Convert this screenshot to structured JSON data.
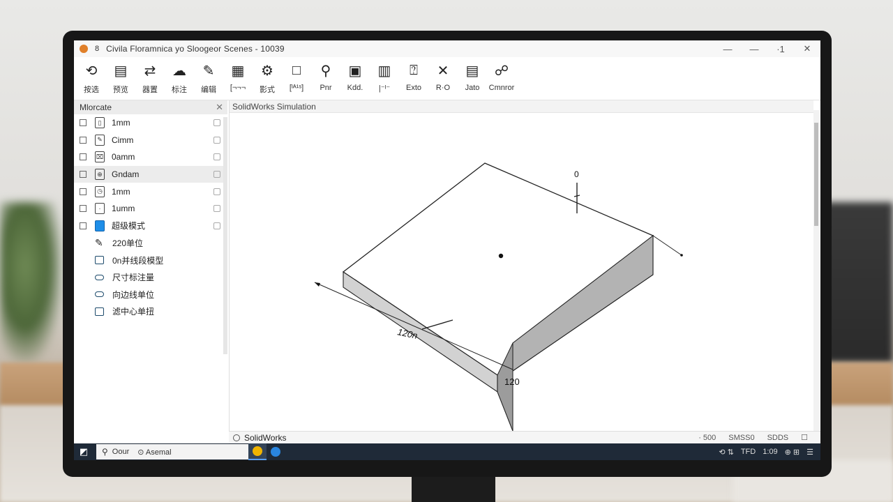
{
  "window": {
    "title": "Civila Floramnica yo Sloogeor Scenes - 10039",
    "pin": "8",
    "minimize": "—",
    "restore": "—",
    "extra": "·1",
    "close": "✕"
  },
  "toolbar": {
    "items": [
      {
        "icon": "⟲",
        "label": "按选",
        "icon_name": "sketch-icon"
      },
      {
        "icon": "▤",
        "label": "预览",
        "icon_name": "preview-icon"
      },
      {
        "icon": "⇄",
        "label": "器置",
        "icon_name": "swap-icon"
      },
      {
        "icon": "☁",
        "label": "标注",
        "icon_name": "cloud-icon"
      },
      {
        "icon": "✎",
        "label": "编辑",
        "icon_name": "edit-icon"
      },
      {
        "icon": "▦",
        "label": "[¬¬¬",
        "icon_name": "document-icon"
      },
      {
        "icon": "⚙",
        "label": "影式",
        "icon_name": "mode-icon"
      },
      {
        "icon": "□",
        "label": "[ᴵᴬ¹ˢ]",
        "icon_name": "box-icon"
      },
      {
        "icon": "⚲",
        "label": "Pnr",
        "icon_name": "pin-icon"
      },
      {
        "icon": "▣",
        "label": "Kdd.",
        "icon_name": "kd-icon"
      },
      {
        "icon": "▥",
        "label": "|⁻ᴵ⁻",
        "icon_name": "frame-icon"
      },
      {
        "icon": "⍰",
        "label": "Exto",
        "icon_name": "extrude-icon"
      },
      {
        "icon": "✕",
        "label": "R·O",
        "icon_name": "cross-icon"
      },
      {
        "icon": "▤",
        "label": "Jato",
        "icon_name": "list-icon"
      },
      {
        "icon": "☍",
        "label": "Cmnror",
        "icon_name": "hand-icon"
      }
    ]
  },
  "feature_manager": {
    "title": "Mlorcate",
    "close": "✕",
    "items": [
      {
        "label": "1mm",
        "icon": "▯",
        "selected": false
      },
      {
        "label": "Cimm",
        "icon": "✎",
        "selected": false
      },
      {
        "label": "0amm",
        "icon": "⌧",
        "selected": false
      },
      {
        "label": "Gndam",
        "icon": "⊕",
        "selected": true
      },
      {
        "label": "1mm",
        "icon": "◷",
        "selected": false
      },
      {
        "label": "1umm",
        "icon": "·",
        "selected": false
      },
      {
        "label": "超级模式",
        "icon": "",
        "selected": false,
        "blue": true
      }
    ],
    "sub_items": [
      {
        "label": "220单位",
        "kind": "pen"
      },
      {
        "label": "0n并线段模型",
        "kind": "rect"
      },
      {
        "label": "尺寸标注量",
        "kind": "oval"
      },
      {
        "label": "向边线单位",
        "kind": "oval"
      },
      {
        "label": "滤中心单扭",
        "kind": "rect"
      }
    ]
  },
  "viewport": {
    "title": "SolidWorks Simulation",
    "dim_top": "0",
    "dim_front": "120n",
    "dim_bottom": "120"
  },
  "status": {
    "title": "SolidWorks",
    "seg1": "· 500",
    "seg2": "SMSS0",
    "seg3": "SDDS",
    "seg4": "☐"
  },
  "taskbar": {
    "start": "◩",
    "search_placeholder": "Oour",
    "search_app": "⊙ Asemal",
    "tray": [
      "⟲ ⇅",
      "TFD",
      "1:09",
      "⊕ ⊞",
      "☰"
    ]
  }
}
